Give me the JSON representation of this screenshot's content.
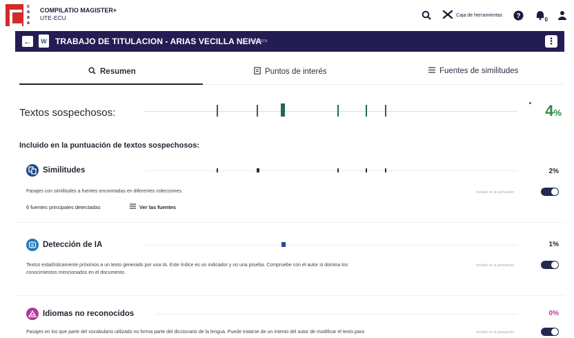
{
  "header": {
    "brand": "COMPILATIO MAGISTER+",
    "institution": "UTE-ECU",
    "logo_stack": [
      "c",
      "a",
      "a",
      "a"
    ],
    "tools_label": "Caja de herramientas",
    "notification_count": "0"
  },
  "document": {
    "title": "TRABAJO DE TITULACION - ARIAS VECILLA NEIVA",
    "id": "#HG67ED6"
  },
  "tabs": [
    {
      "label": "Resumen",
      "icon": "search-icon"
    },
    {
      "label": "Puntos de interés",
      "icon": "bookmark-icon"
    },
    {
      "label": "Fuentes de similitudes",
      "icon": "list-icon"
    }
  ],
  "suspicious": {
    "label": "Textos sospechosos:",
    "score": "4",
    "unit": "%",
    "color": "#2e8a43"
  },
  "included_label": "Incluido en la puntuación de textos sospechosos:",
  "sections": [
    {
      "title": "Similitudes",
      "score": "2%",
      "icon": "similarity-icon",
      "color": "#1f4b84",
      "description": [
        "Pasajes con similitudes a fuentes encontradas en diferentes colecciones."
      ],
      "sources_detected": "6 fuentes principales detectadas",
      "view_sources": "Ver las fuentes",
      "toggle_label": "Incluido en la puntuación",
      "toggle_on": true
    },
    {
      "title": "Detección de IA",
      "score": "1%",
      "icon": "ai-icon",
      "color": "#1e7ab8",
      "description": [
        "Textos estadísticamente próximos a un texto generado por una IA. Este índice es un indicador y no una prueba. Compruebe con el autor si domina los",
        "conocimientos mencionados en el documento."
      ],
      "toggle_label": "Incluido en la puntuación",
      "toggle_on": true
    },
    {
      "title": "Idiomas no reconocidos",
      "score": "0%",
      "icon": "language-icon",
      "color": "#b03a9a",
      "description": [
        "Pasajes en los que parte del vocabulario utilizado no forma parte del diccionario de la lengua. Puede tratarse de un intento del autor de modificar el texto para"
      ],
      "toggle_label": "Incluido en la puntuación",
      "toggle_on": true
    }
  ]
}
